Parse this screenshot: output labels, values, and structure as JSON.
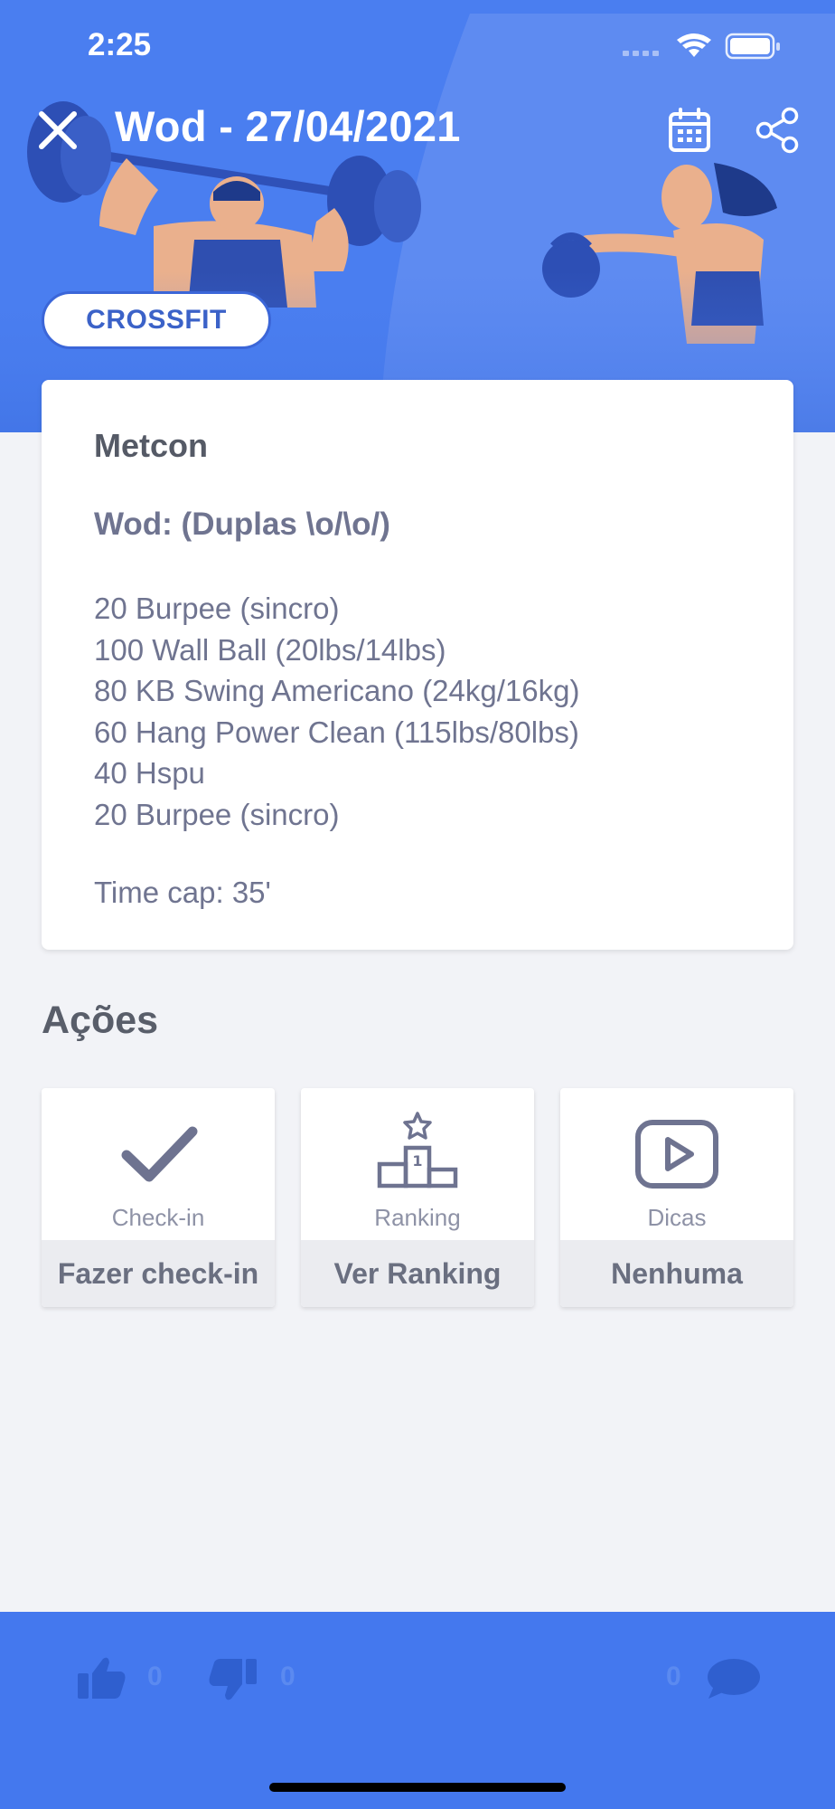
{
  "status_bar": {
    "time": "2:25"
  },
  "header": {
    "title": "Wod - 27/04/2021",
    "tag": "CROSSFIT",
    "accent_color": "#4a7ef0"
  },
  "workout": {
    "section": "Metcon",
    "subtitle": "Wod: (Duplas \\o/\\o/)",
    "lines": [
      "20 Burpee (sincro)",
      "100 Wall Ball (20lbs/14lbs)",
      "80 KB Swing Americano (24kg/16kg)",
      "60 Hang Power Clean (115lbs/80lbs)",
      "40 Hspu",
      "20 Burpee (sincro)"
    ],
    "time_cap": "Time cap: 35'"
  },
  "actions": {
    "title": "Ações",
    "items": [
      {
        "icon": "check-icon",
        "caption": "Check-in",
        "label": "Fazer check-in"
      },
      {
        "icon": "podium-icon",
        "caption": "Ranking",
        "label": "Ver Ranking"
      },
      {
        "icon": "play-icon",
        "caption": "Dicas",
        "label": "Nenhuma"
      }
    ]
  },
  "bottom_bar": {
    "likes": "0",
    "dislikes": "0",
    "comments": "0",
    "color": "#4478ee"
  }
}
